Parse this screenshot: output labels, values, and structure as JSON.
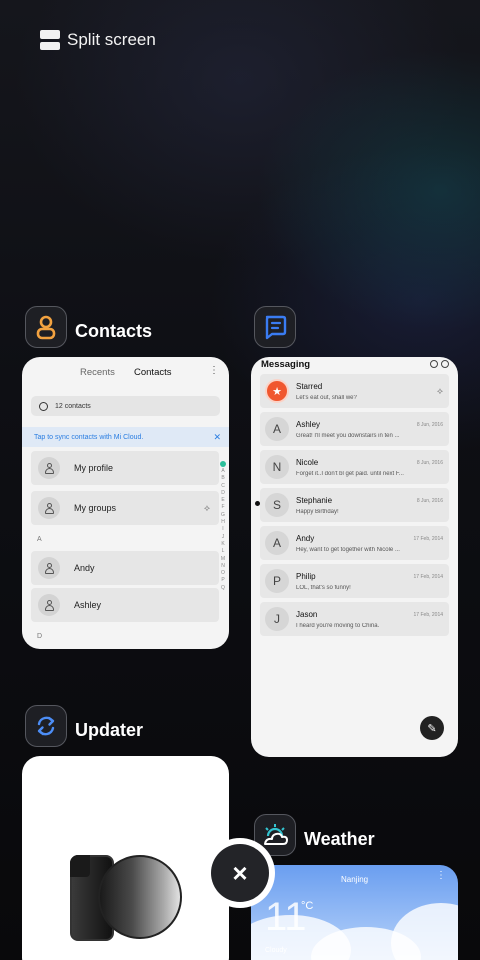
{
  "split_screen": {
    "label": "Split screen",
    "icon": "split-screen-icon"
  },
  "apps": {
    "contacts": {
      "title": "Contacts",
      "icon": "contacts-icon",
      "icon_color": "#f2a240",
      "tabs": [
        "Recents",
        "Contacts"
      ],
      "search_text": "12 contacts",
      "sync_banner": "Tap to sync contacts with Mi Cloud.",
      "rows": [
        {
          "label": "My profile"
        },
        {
          "label": "My groups"
        }
      ],
      "section_a": "A",
      "contacts": [
        {
          "name": "Andy"
        },
        {
          "name": "Ashley"
        }
      ],
      "section_d": "D",
      "index_letters": [
        "A",
        "B",
        "C",
        "D",
        "E",
        "F",
        "G",
        "H",
        "I",
        "J",
        "K",
        "L",
        "M",
        "N",
        "O",
        "P",
        "Q"
      ]
    },
    "messaging": {
      "title": "Messaging",
      "icon": "messaging-icon",
      "icon_color": "#3a7cf2",
      "threads": [
        {
          "avatar": "★",
          "name": "Starred",
          "preview": "Let's eat out, shall we?",
          "date": ""
        },
        {
          "avatar": "A",
          "name": "Ashley",
          "preview": "Great! I'll meet you downstairs in ten ...",
          "date": "8 Jun, 2016"
        },
        {
          "avatar": "N",
          "name": "Nicole",
          "preview": "Forget it..I don't bl get paid. until next F...",
          "date": "8 Jun, 2016"
        },
        {
          "avatar": "S",
          "name": "Stephanie",
          "preview": "Happy Birthday!",
          "date": "8 Jun, 2016"
        },
        {
          "avatar": "A",
          "name": "Andy",
          "preview": "Hey, want to get together with Nicole ...",
          "date": "17 Feb, 2014"
        },
        {
          "avatar": "P",
          "name": "Philip",
          "preview": "LOL, that's so funny!",
          "date": "17 Feb, 2014"
        },
        {
          "avatar": "J",
          "name": "Jason",
          "preview": "I heard you're moving to China.",
          "date": "17 Feb, 2014"
        }
      ]
    },
    "updater": {
      "title": "Updater",
      "icon": "updater-icon",
      "icon_color": "#4c8df5"
    },
    "weather": {
      "title": "Weather",
      "icon": "weather-icon",
      "icon_color": "#33c3d0",
      "city": "Nanjing",
      "temperature": "11",
      "unit": "°C",
      "condition": "Cloudy"
    }
  },
  "close_button": {
    "label": "×",
    "icon": "close-icon"
  }
}
